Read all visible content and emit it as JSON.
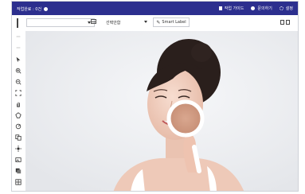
{
  "topbar": {
    "status": "작업완료 : 0건",
    "guide_label": "작업 가이드",
    "question_label": "문의하기",
    "settings_label": "설정"
  },
  "toolbar": {
    "view_select_value": "",
    "label_select_value": "선택안함",
    "smart_label": "Smart Label"
  },
  "sidebar": {
    "tools": [
      "undo-icon",
      "redo-icon",
      "pointer-icon",
      "zoom-in-icon",
      "zoom-out-icon",
      "fit-icon",
      "hand-icon",
      "polygon-icon",
      "magic-icon",
      "copy-icon",
      "brightness-icon",
      "image-icon",
      "layers-icon",
      "grid-icon"
    ]
  },
  "colors": {
    "topbar": "#2c2f8e",
    "canvas": "#eeeff1"
  }
}
